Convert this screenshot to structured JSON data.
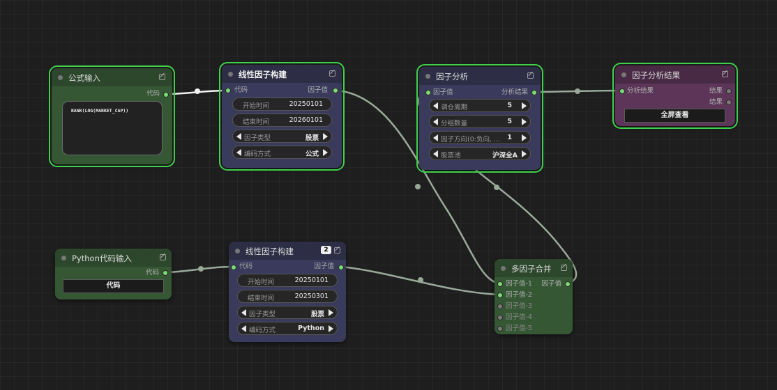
{
  "colors": {
    "accent_selected": "#3fd14b",
    "port": "#7bdc72",
    "wire": "#9aaa9a"
  },
  "nodes": {
    "formula_input": {
      "title": "公式输入",
      "out_label": "代码",
      "code": "RANK(LOG(MARKET_CAP))"
    },
    "linear_factor_1": {
      "title": "线性因子构建",
      "in_label": "代码",
      "out_label": "因子值",
      "start_label": "开始时间",
      "start_value": "20250101",
      "end_label": "结束时间",
      "end_value": "20260101",
      "type_label": "因子类型",
      "type_value": "股票",
      "enc_label": "编码方式",
      "enc_value": "公式"
    },
    "factor_analysis": {
      "title": "因子分析",
      "in_label": "因子值",
      "out_label": "分析结果",
      "period_label": "调仓周期",
      "period_value": "5",
      "groups_label": "分组数量",
      "groups_value": "5",
      "dir_label": "因子方向(0:负向, ...",
      "dir_value": "1",
      "pool_label": "股票池",
      "pool_value": "沪深全A"
    },
    "factor_result": {
      "title": "因子分析结果",
      "in_label": "分析结果",
      "out1": "结果",
      "out2": "结果",
      "button": "全屏查看"
    },
    "python_input": {
      "title": "Python代码输入",
      "out_label": "代码",
      "button": "代码"
    },
    "linear_factor_2": {
      "title": "线性因子构建",
      "badge": "2",
      "in_label": "代码",
      "out_label": "因子值",
      "start_label": "开始时间",
      "start_value": "20250101",
      "end_label": "结束时间",
      "end_value": "20250301",
      "type_label": "因子类型",
      "type_value": "股票",
      "enc_label": "编码方式",
      "enc_value": "Python"
    },
    "multi_merge": {
      "title": "多因子合并",
      "out_label": "因子值",
      "inputs": [
        "因子值-1",
        "因子值-2",
        "因子值-3",
        "因子值-4",
        "因子值-5"
      ]
    }
  }
}
